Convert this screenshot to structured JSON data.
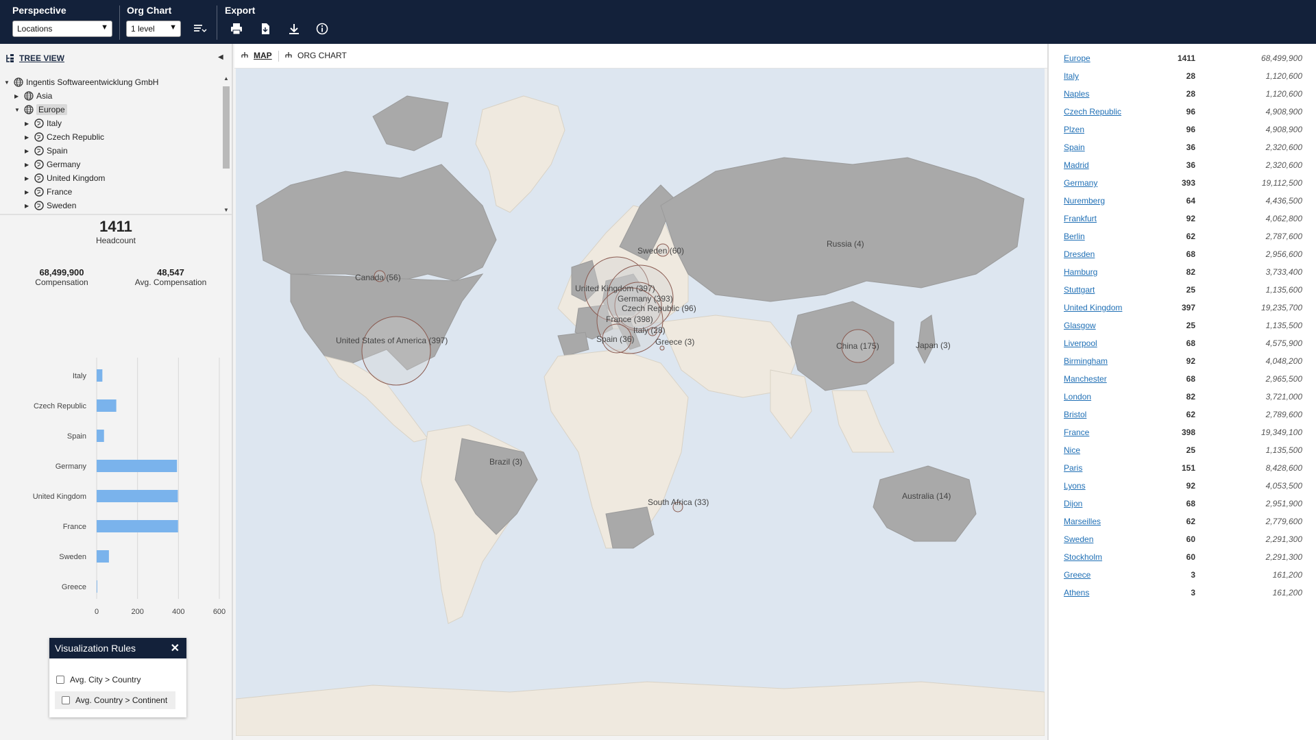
{
  "toolbar": {
    "perspective_label": "Perspective",
    "perspective_value": "Locations",
    "orgchart_label": "Org Chart",
    "level_value": "1 level",
    "export_label": "Export"
  },
  "treeview": {
    "title": "TREE VIEW",
    "items": [
      {
        "label": "Ingentis Softwareentwicklung GmbH"
      },
      {
        "label": "Asia"
      },
      {
        "label": "Europe"
      },
      {
        "label": "Italy"
      },
      {
        "label": "Czech Republic"
      },
      {
        "label": "Spain"
      },
      {
        "label": "Germany"
      },
      {
        "label": "United Kingdom"
      },
      {
        "label": "France"
      },
      {
        "label": "Sweden"
      }
    ]
  },
  "kpis": {
    "headcount_value": "1411",
    "headcount_label": "Headcount",
    "comp_value": "68,499,900",
    "comp_label": "Compensation",
    "avg_value": "48,547",
    "avg_label": "Avg. Compensation"
  },
  "chart_data": {
    "type": "bar",
    "orientation": "horizontal",
    "categories": [
      "Italy",
      "Czech Republic",
      "Spain",
      "Germany",
      "United Kingdom",
      "France",
      "Sweden",
      "Greece"
    ],
    "values": [
      28,
      96,
      36,
      393,
      397,
      398,
      60,
      3
    ],
    "xticks": [
      "0",
      "200",
      "400",
      "600"
    ],
    "xlim": [
      0,
      600
    ],
    "grid": true,
    "bar_color": "#7ab3ec"
  },
  "vis_rules": {
    "title": "Visualization Rules",
    "options": [
      "Avg. City > Country",
      "Avg. Country > Continent"
    ]
  },
  "center_tabs": {
    "map": "MAP",
    "org": "ORG CHART"
  },
  "map_labels": [
    "Canada (56)",
    "United States of America (397)",
    "Brazil (3)",
    "Sweden (60)",
    "United Kingdom (397)",
    "Germany (393)",
    "Czech Republic (96)",
    "France (398)",
    "Italy (28)",
    "Spain (36)",
    "Greece (3)",
    "Russia (4)",
    "China (175)",
    "Japan (3)",
    "South Africa (33)",
    "Australia (14)"
  ],
  "right_list": [
    {
      "name": "Europe",
      "hc": "1411",
      "comp": "68,499,900"
    },
    {
      "name": "Italy",
      "hc": "28",
      "comp": "1,120,600"
    },
    {
      "name": "Naples",
      "hc": "28",
      "comp": "1,120,600"
    },
    {
      "name": "Czech Republic",
      "hc": "96",
      "comp": "4,908,900"
    },
    {
      "name": "Plzen",
      "hc": "96",
      "comp": "4,908,900"
    },
    {
      "name": "Spain",
      "hc": "36",
      "comp": "2,320,600"
    },
    {
      "name": "Madrid",
      "hc": "36",
      "comp": "2,320,600"
    },
    {
      "name": "Germany",
      "hc": "393",
      "comp": "19,112,500"
    },
    {
      "name": "Nuremberg",
      "hc": "64",
      "comp": "4,436,500"
    },
    {
      "name": "Frankfurt",
      "hc": "92",
      "comp": "4,062,800"
    },
    {
      "name": "Berlin",
      "hc": "62",
      "comp": "2,787,600"
    },
    {
      "name": "Dresden",
      "hc": "68",
      "comp": "2,956,600"
    },
    {
      "name": "Hamburg",
      "hc": "82",
      "comp": "3,733,400"
    },
    {
      "name": "Stuttgart",
      "hc": "25",
      "comp": "1,135,600"
    },
    {
      "name": "United Kingdom",
      "hc": "397",
      "comp": "19,235,700"
    },
    {
      "name": "Glasgow",
      "hc": "25",
      "comp": "1,135,500"
    },
    {
      "name": "Liverpool",
      "hc": "68",
      "comp": "4,575,900"
    },
    {
      "name": "Birmingham",
      "hc": "92",
      "comp": "4,048,200"
    },
    {
      "name": "Manchester",
      "hc": "68",
      "comp": "2,965,500"
    },
    {
      "name": "London",
      "hc": "82",
      "comp": "3,721,000"
    },
    {
      "name": "Bristol",
      "hc": "62",
      "comp": "2,789,600"
    },
    {
      "name": "France",
      "hc": "398",
      "comp": "19,349,100"
    },
    {
      "name": "Nice",
      "hc": "25",
      "comp": "1,135,500"
    },
    {
      "name": "Paris",
      "hc": "151",
      "comp": "8,428,600"
    },
    {
      "name": "Lyons",
      "hc": "92",
      "comp": "4,053,500"
    },
    {
      "name": "Dijon",
      "hc": "68",
      "comp": "2,951,900"
    },
    {
      "name": "Marseilles",
      "hc": "62",
      "comp": "2,779,600"
    },
    {
      "name": "Sweden",
      "hc": "60",
      "comp": "2,291,300"
    },
    {
      "name": "Stockholm",
      "hc": "60",
      "comp": "2,291,300"
    },
    {
      "name": "Greece",
      "hc": "3",
      "comp": "161,200"
    },
    {
      "name": "Athens",
      "hc": "3",
      "comp": "161,200"
    }
  ]
}
